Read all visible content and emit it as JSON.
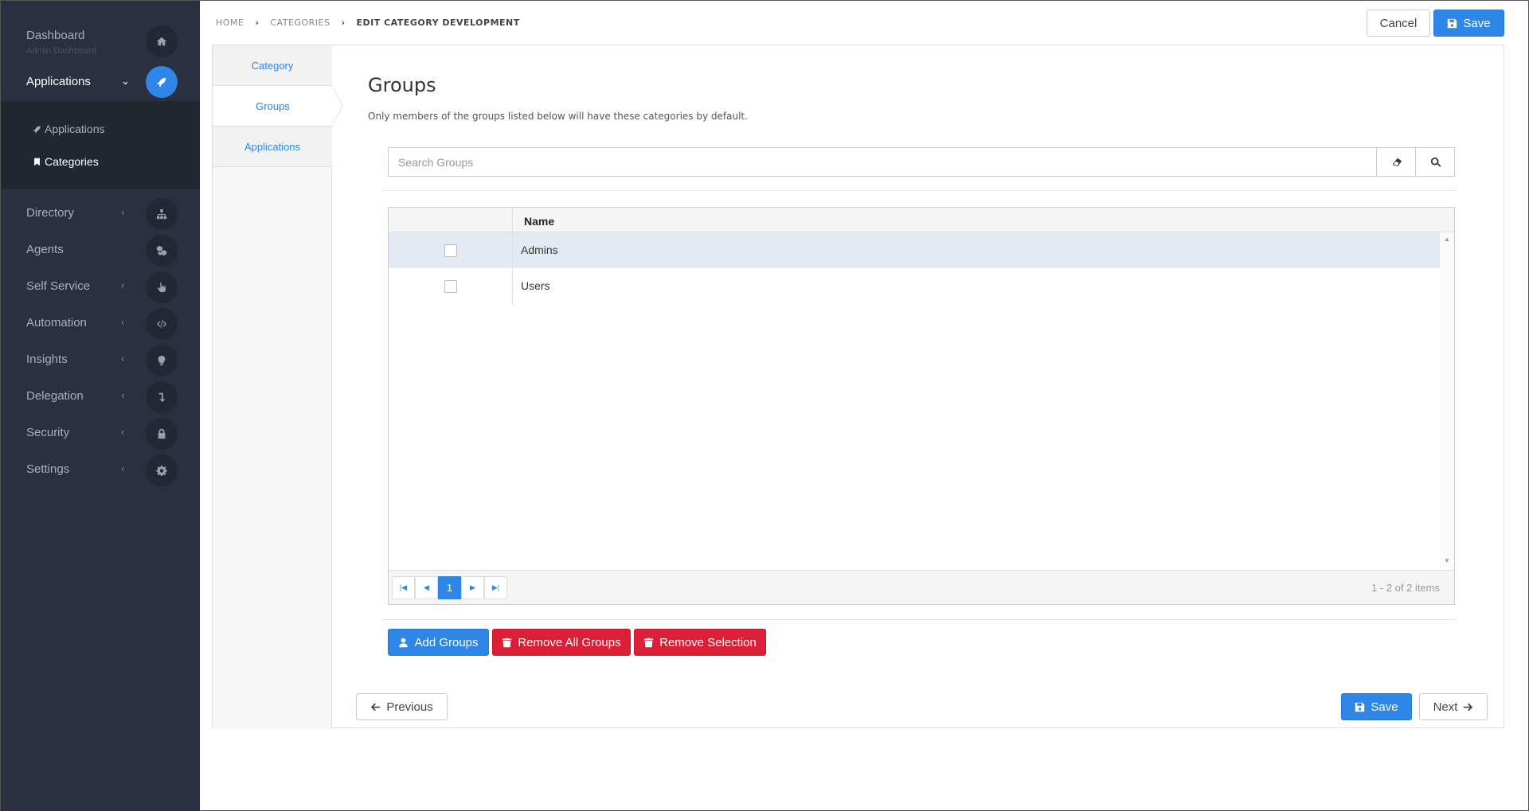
{
  "sidebar": {
    "dashboard": {
      "label": "Dashboard",
      "sublabel": "Admin Dashboard"
    },
    "applications": {
      "label": "Applications"
    },
    "submenu": [
      {
        "label": "Applications"
      },
      {
        "label": "Categories"
      }
    ],
    "items": [
      {
        "label": "Directory"
      },
      {
        "label": "Agents"
      },
      {
        "label": "Self Service"
      },
      {
        "label": "Automation"
      },
      {
        "label": "Insights"
      },
      {
        "label": "Delegation"
      },
      {
        "label": "Security"
      },
      {
        "label": "Settings"
      }
    ]
  },
  "breadcrumb": {
    "home": "HOME",
    "categories": "CATEGORIES",
    "current": "EDIT CATEGORY DEVELOPMENT"
  },
  "header": {
    "cancel_label": "Cancel",
    "save_label": "Save"
  },
  "tabs": [
    {
      "label": "Category"
    },
    {
      "label": "Groups"
    },
    {
      "label": "Applications"
    }
  ],
  "groups": {
    "title": "Groups",
    "description": "Only members of the groups listed below will have these categories by default.",
    "search_placeholder": "Search Groups",
    "column_name": "Name",
    "rows": [
      {
        "name": "Admins"
      },
      {
        "name": "Users"
      }
    ],
    "pager": {
      "current_page": "1",
      "info": "1 - 2 of 2 items"
    },
    "add_label": "Add Groups",
    "remove_all_label": "Remove All Groups",
    "remove_selection_label": "Remove Selection"
  },
  "footer": {
    "previous_label": "Previous",
    "save_label": "Save",
    "next_label": "Next"
  },
  "colors": {
    "sidebar_bg": "#2b3040",
    "primary": "#2e86e6",
    "danger": "#dc1f36"
  }
}
